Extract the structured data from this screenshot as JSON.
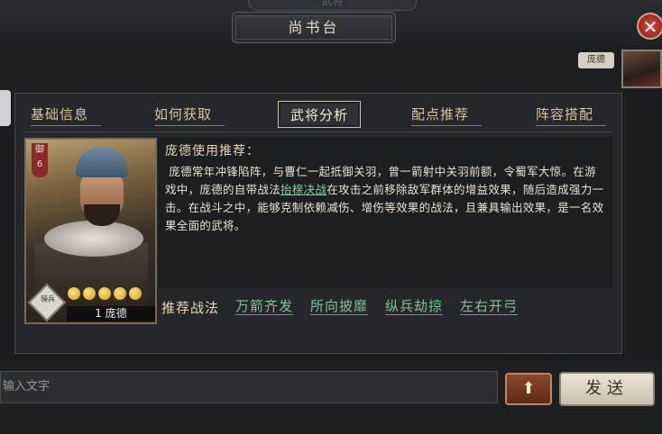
{
  "header": {
    "top_ghost_label": "武将",
    "title": "尚书台",
    "close_icon": "close-icon"
  },
  "chat_preview": {
    "name_tag": "庞德"
  },
  "tabs": [
    {
      "label": "基础信息",
      "active": false
    },
    {
      "label": "如何获取",
      "active": false
    },
    {
      "label": "武将分析",
      "active": true
    },
    {
      "label": "配点推荐",
      "active": false
    },
    {
      "label": "阵容搭配",
      "active": false
    }
  ],
  "card": {
    "rank_label": "御",
    "rank_value": "6",
    "badge": "骑兵",
    "stars": 5,
    "level_name": "1 庞德"
  },
  "analysis": {
    "section_title": "庞德使用推荐：",
    "para_1": "庞德常年冲锋陷阵，与曹仁一起抵御关羽，曾一箭射中关羽前额，令蜀军大惊。在游戏中，庞德的自带战法",
    "tactic_link": "抬榇决战",
    "para_2": "在攻击之前移除敌军群体的增益效果，随后造成强力一击。在战斗之中，能够克制依赖减伤、增伤等效果的战法，且兼具输出效果，是一名效果全面的武将。"
  },
  "recommend": {
    "label": "推荐战法",
    "tactics": [
      "万箭齐发",
      "所向披靡",
      "纵兵劫掠",
      "左右开弓"
    ]
  },
  "chat_bar": {
    "input_placeholder": "输入文字",
    "up_icon": "arrow-up-icon",
    "send_label": "发送"
  },
  "colors": {
    "accent_gold": "#d6c49c",
    "link_green": "#7fc39d",
    "close_red": "#b23227"
  }
}
